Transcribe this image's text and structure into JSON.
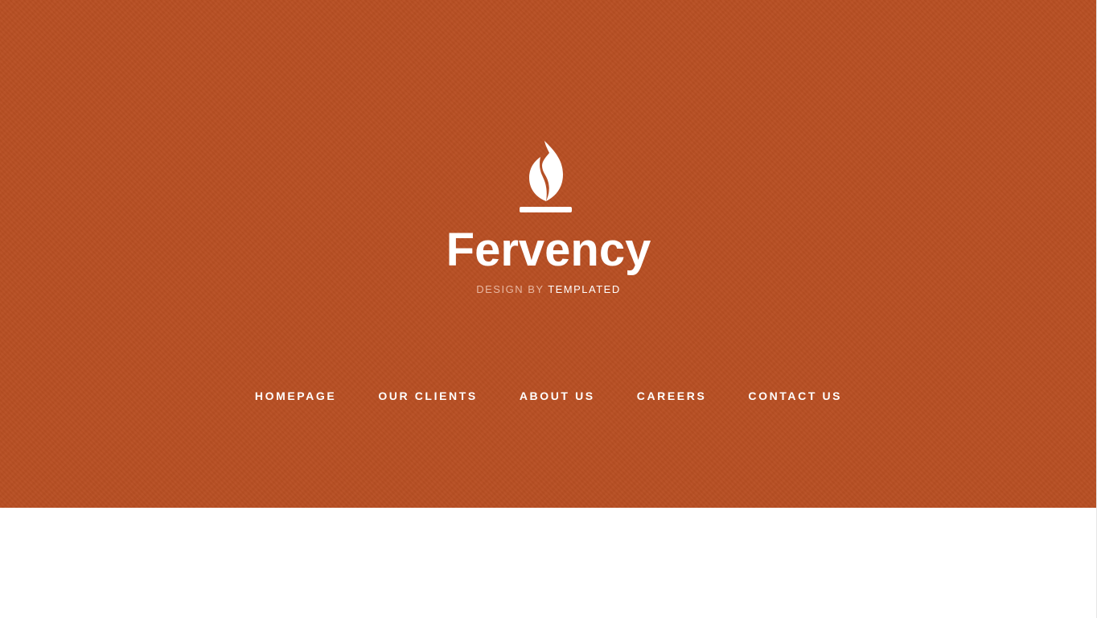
{
  "header": {
    "logo_icon": "flame-icon",
    "site_title": "Fervency",
    "byline_prefix": "DESIGN BY",
    "byline_brand": "TEMPLATED"
  },
  "nav": {
    "items": [
      {
        "label": "HOMEPAGE"
      },
      {
        "label": "OUR CLIENTS"
      },
      {
        "label": "ABOUT US"
      },
      {
        "label": "CAREERS"
      },
      {
        "label": "CONTACT US"
      }
    ]
  },
  "colors": {
    "header_background": "#b84f23",
    "text_primary": "#ffffff",
    "byline_muted": "#e8b7a1",
    "page_background": "#ffffff"
  }
}
